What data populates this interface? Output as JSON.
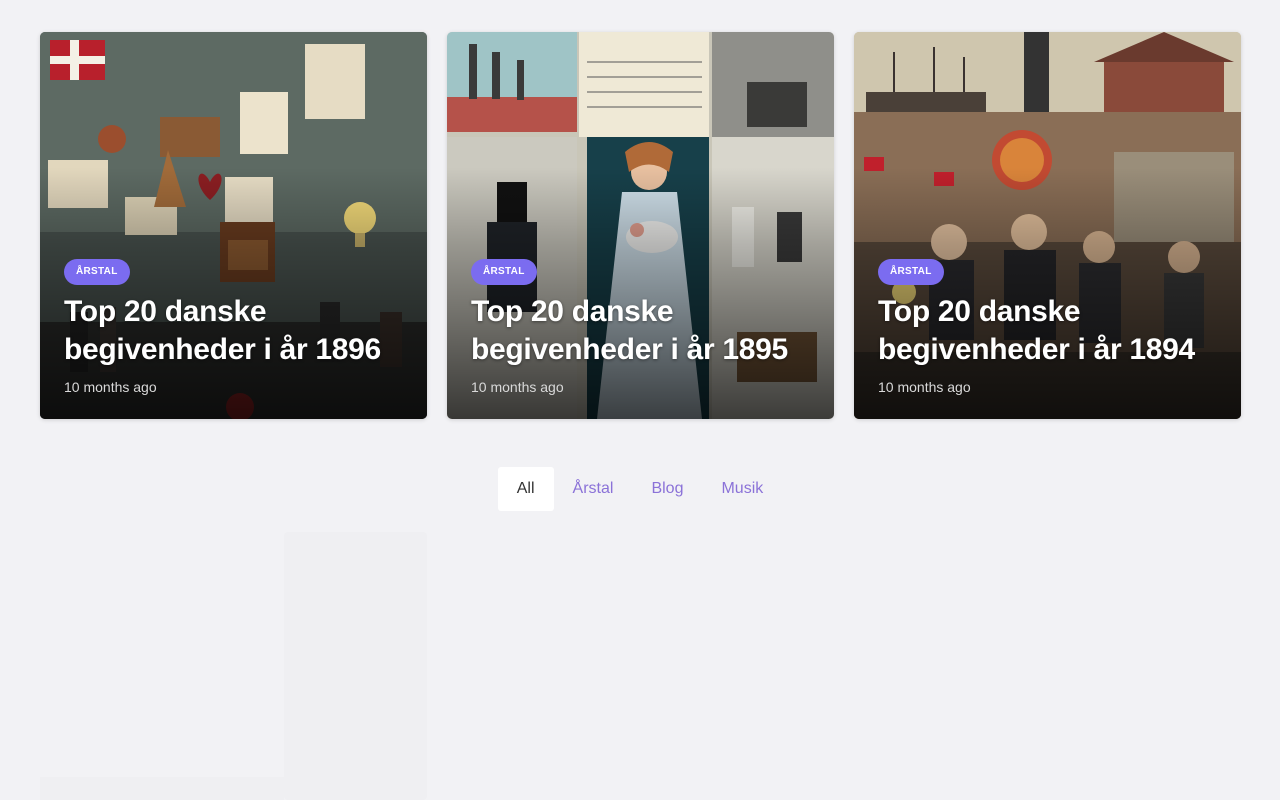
{
  "cards": [
    {
      "category": "Årstal",
      "title": "Top 20 danske begivenheder i år 1896",
      "date": "10 months ago"
    },
    {
      "category": "Årstal",
      "title": "Top 20 danske begivenheder i år 1895",
      "date": "10 months ago"
    },
    {
      "category": "Årstal",
      "title": "Top 20 danske begivenheder i år 1894",
      "date": "10 months ago"
    }
  ],
  "filter_tabs": [
    {
      "label": "All",
      "active": true
    },
    {
      "label": "Årstal",
      "active": false
    },
    {
      "label": "Blog",
      "active": false
    },
    {
      "label": "Musik",
      "active": false
    }
  ],
  "colors": {
    "background": "#f2f2f5",
    "badge": "#7b6cf0",
    "tab_link": "#8b72d8",
    "active_tab_bg": "#ffffff"
  }
}
